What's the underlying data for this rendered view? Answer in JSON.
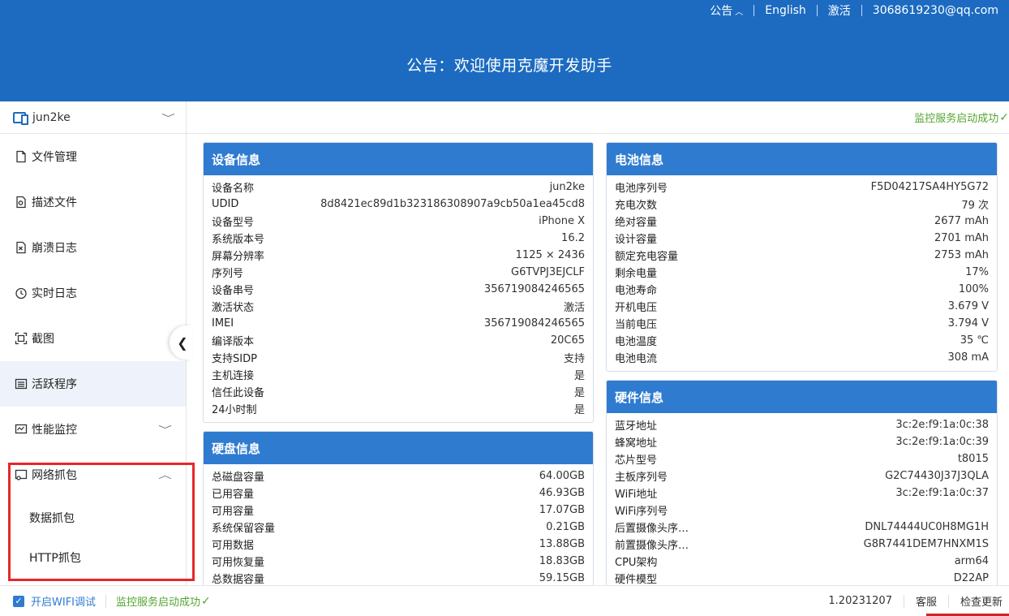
{
  "header": {
    "nav": {
      "announcement": "公告",
      "language": "English",
      "activate": "激活",
      "account": "3068619230@qq.com"
    },
    "title": "公告：欢迎使用克魔开发助手"
  },
  "sidebar": {
    "device": "jun2ke",
    "items": [
      {
        "label": "文件管理"
      },
      {
        "label": "描述文件"
      },
      {
        "label": "崩溃日志"
      },
      {
        "label": "实时日志"
      },
      {
        "label": "截图"
      },
      {
        "label": "活跃程序"
      },
      {
        "label": "性能监控"
      },
      {
        "label": "网络抓包"
      }
    ],
    "subitems": [
      {
        "label": "数据抓包"
      },
      {
        "label": "HTTP抓包"
      }
    ]
  },
  "main": {
    "status": "监控服务启动成功"
  },
  "device_info": {
    "title": "设备信息",
    "rows": [
      {
        "k": "设备名称",
        "v": "jun2ke"
      },
      {
        "k": "UDID",
        "v": "8d8421ec89d1b323186308907a9cb50a1ea45cd8"
      },
      {
        "k": "设备型号",
        "v": "iPhone X"
      },
      {
        "k": "系统版本号",
        "v": "16.2"
      },
      {
        "k": "屏幕分辨率",
        "v": "1125 × 2436"
      },
      {
        "k": "序列号",
        "v": "G6TVPJ3EJCLF"
      },
      {
        "k": "设备串号",
        "v": "356719084246565"
      },
      {
        "k": "激活状态",
        "v": "激活"
      },
      {
        "k": "IMEI",
        "v": "356719084246565"
      },
      {
        "k": "编译版本",
        "v": "20C65"
      },
      {
        "k": "支持SIDP",
        "v": "支持"
      },
      {
        "k": "主机连接",
        "v": "是"
      },
      {
        "k": "信任此设备",
        "v": "是"
      },
      {
        "k": "24小时制",
        "v": "是"
      }
    ]
  },
  "disk_info": {
    "title": "硬盘信息",
    "rows": [
      {
        "k": "总磁盘容量",
        "v": "64.00GB"
      },
      {
        "k": "已用容量",
        "v": "46.93GB"
      },
      {
        "k": "可用容量",
        "v": "17.07GB"
      },
      {
        "k": "系统保留容量",
        "v": "0.21GB"
      },
      {
        "k": "可用数据",
        "v": "13.88GB"
      },
      {
        "k": "可用恢复量",
        "v": "18.83GB"
      },
      {
        "k": "总数据容量",
        "v": "59.15GB"
      }
    ]
  },
  "battery_info": {
    "title": "电池信息",
    "rows": [
      {
        "k": "电池序列号",
        "v": "F5D04217SA4HY5G72"
      },
      {
        "k": "充电次数",
        "v": "79 次"
      },
      {
        "k": "绝对容量",
        "v": "2677 mAh"
      },
      {
        "k": "设计容量",
        "v": "2701 mAh"
      },
      {
        "k": "额定充电容量",
        "v": "2753 mAh"
      },
      {
        "k": "剩余电量",
        "v": "17%"
      },
      {
        "k": "电池寿命",
        "v": "100%"
      },
      {
        "k": "开机电压",
        "v": "3.679 V"
      },
      {
        "k": "当前电压",
        "v": "3.794 V"
      },
      {
        "k": "电池温度",
        "v": "35 ℃"
      },
      {
        "k": "电池电流",
        "v": "308 mA"
      }
    ]
  },
  "hardware_info": {
    "title": "硬件信息",
    "rows": [
      {
        "k": "蓝牙地址",
        "v": "3c:2e:f9:1a:0c:38"
      },
      {
        "k": "蜂窝地址",
        "v": "3c:2e:f9:1a:0c:39"
      },
      {
        "k": "芯片型号",
        "v": "t8015"
      },
      {
        "k": "主板序列号",
        "v": "G2C74430J37J3QLA"
      },
      {
        "k": "WiFi地址",
        "v": "3c:2e:f9:1a:0c:37"
      },
      {
        "k": "WiFi序列号",
        "v": ""
      },
      {
        "k": "后置摄像头序…",
        "v": "DNL74444UC0H8MG1H"
      },
      {
        "k": "前置摄像头序…",
        "v": "G8R7441DEM7HNXM1S"
      },
      {
        "k": "CPU架构",
        "v": "arm64"
      },
      {
        "k": "硬件模型",
        "v": "D22AP"
      }
    ]
  },
  "footer": {
    "wifi_debug": "开启WIFI调试",
    "status": "监控服务启动成功",
    "version": "1.20231207",
    "support": "客服",
    "update": "检查更新"
  }
}
